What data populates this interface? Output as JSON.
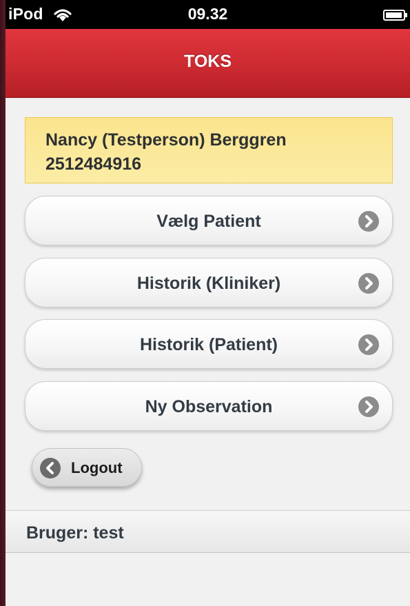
{
  "status_bar": {
    "carrier": "iPod",
    "time": "09.32",
    "wifi_icon": "wifi-icon",
    "battery_icon": "battery-icon"
  },
  "header": {
    "title": "TOKS",
    "color": "#cc2a31"
  },
  "patient": {
    "name": "Nancy (Testperson) Berggren",
    "cpr": "2512484916",
    "background_color": "#fbe48e"
  },
  "menu": {
    "items": [
      {
        "label": "Vælg Patient",
        "icon": "chevron-right-icon"
      },
      {
        "label": "Historik (Kliniker)",
        "icon": "chevron-right-icon"
      },
      {
        "label": "Historik (Patient)",
        "icon": "chevron-right-icon"
      },
      {
        "label": "Ny Observation",
        "icon": "chevron-right-icon"
      }
    ]
  },
  "logout": {
    "label": "Logout",
    "icon": "chevron-left-icon"
  },
  "footer": {
    "user_label": "Bruger: test"
  }
}
